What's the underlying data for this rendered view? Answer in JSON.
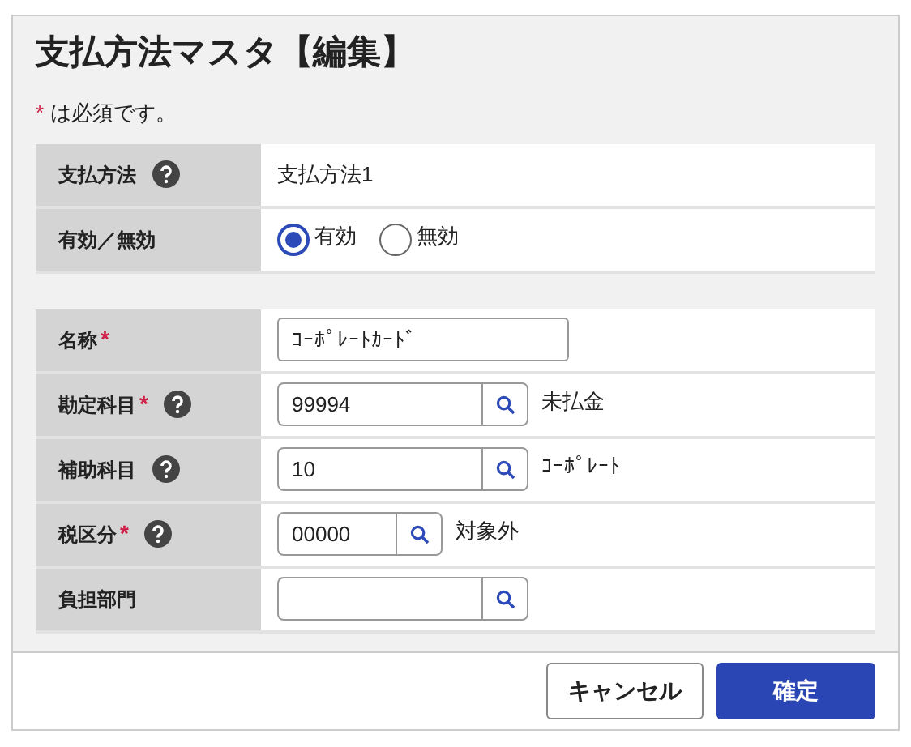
{
  "title": "支払方法マスタ【編集】",
  "required_note": {
    "mark": "*",
    "text": "は必須です。"
  },
  "sections": [
    {
      "rows": [
        {
          "label": "支払方法",
          "help": true,
          "kind": "text",
          "value": "支払方法1"
        },
        {
          "label": "有効／無効",
          "help": false,
          "kind": "radio",
          "options": [
            {
              "label": "有効",
              "selected": true
            },
            {
              "label": "無効",
              "selected": false
            }
          ]
        }
      ]
    },
    {
      "rows": [
        {
          "label": "名称",
          "required_mark": "*",
          "help": false,
          "kind": "input",
          "value": "ｺｰﾎﾟﾚｰﾄｶｰﾄﾞ"
        },
        {
          "label": "勘定科目",
          "required_mark": "*",
          "help": true,
          "kind": "lookup",
          "value": "99994",
          "description": "未払金"
        },
        {
          "label": "補助科目",
          "help": true,
          "kind": "lookup",
          "value": "10",
          "description": "ｺｰﾎﾟﾚｰﾄ"
        },
        {
          "label": "税区分",
          "required_mark": "*",
          "help": true,
          "kind": "short_lookup",
          "value": "00000",
          "description": "対象外"
        },
        {
          "label": "負担部門",
          "help": false,
          "kind": "lookup",
          "value": ""
        }
      ]
    }
  ],
  "buttons": [
    {
      "label": "キャンセル",
      "kind": "secondary"
    },
    {
      "label": "確定",
      "kind": "primary"
    }
  ]
}
